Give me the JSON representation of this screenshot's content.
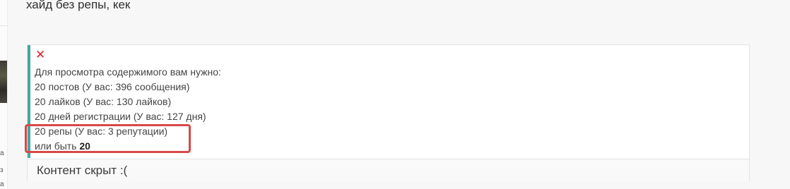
{
  "post": {
    "text": "хайд без репы, кек"
  },
  "hide_block": {
    "close_symbol": "✕",
    "intro": "Для просмотра содержимого вам нужно:",
    "requirements": [
      "20 постов (У вас: 396 сообщения)",
      "20 лайков (У вас: 130 лайков)",
      "20 дней регистрации (У вас: 127 дня)",
      "20 репы (У вас: 3 репутации)"
    ],
    "alternative_prefix": "или быть",
    "alternative_value": "20",
    "footer_text": "Контент скрыт :("
  },
  "colors": {
    "accent_border": "#46a6a0",
    "close_red": "#d9202a",
    "highlight_red": "#d84848"
  },
  "left_rail": {
    "glyphs": [
      "а",
      "з",
      "а"
    ]
  }
}
